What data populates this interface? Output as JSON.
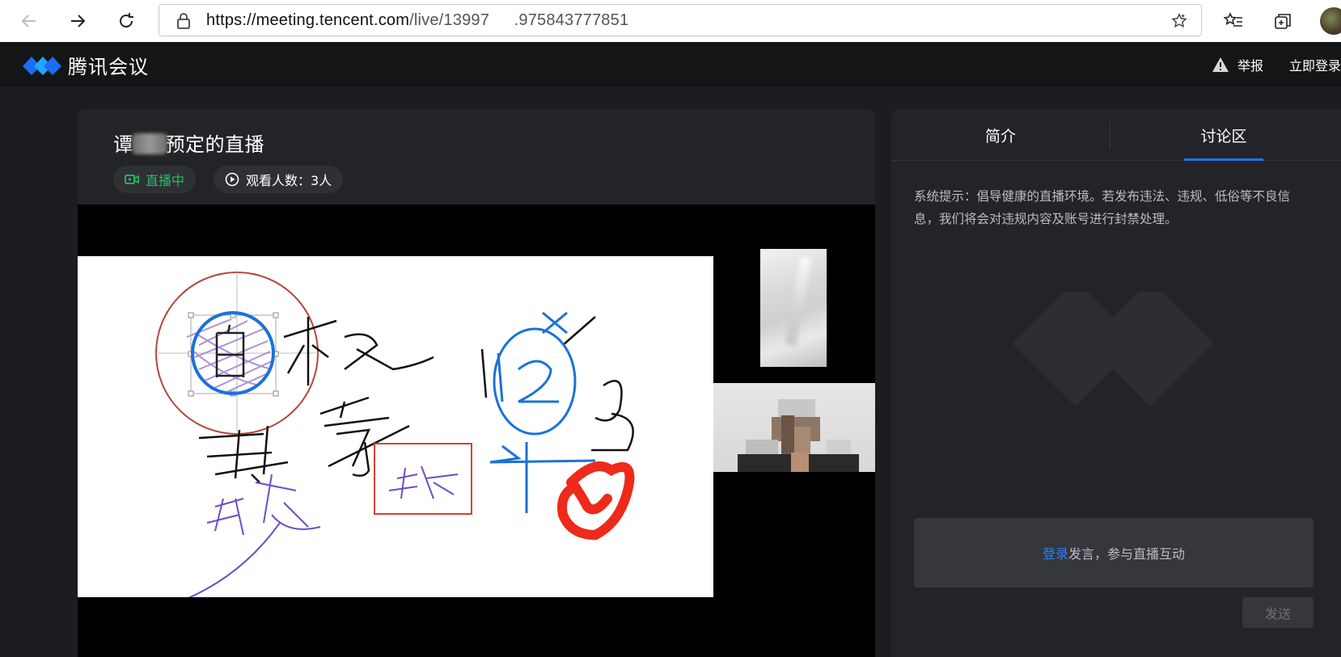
{
  "browser": {
    "url_host": "https://meeting.tencent.com",
    "url_path": "/live/13997   .975843777851"
  },
  "header": {
    "logo_text": "腾讯会议",
    "report_label": "举报",
    "login_label": "立即登录"
  },
  "live": {
    "title_prefix": "谭",
    "title_suffix": "预定的直播",
    "status_label": "直播中",
    "viewers_label": "观看人数：3人",
    "status_color": "#21c05f"
  },
  "side": {
    "tabs": [
      {
        "label": "简介"
      },
      {
        "label": "讨论区",
        "active": true
      }
    ],
    "system_tip": "系统提示：倡导健康的直播环境。若发布违法、违规、低俗等不良信息，我们将会对违规内容及账号进行封禁处理。",
    "chat_login_link": "登录",
    "chat_prompt": "发言，参与直播互动",
    "send_label": "发送",
    "accent_color": "#1f73e8"
  },
  "icons": {
    "back": "arrow-left-icon",
    "forward": "arrow-right-icon",
    "refresh": "refresh-icon",
    "lock": "lock-icon",
    "star": "star-icon",
    "favorites": "favorites-icon",
    "collections": "collections-icon",
    "warning": "warning-icon",
    "camera": "video-camera-icon",
    "play": "play-circle-icon"
  }
}
